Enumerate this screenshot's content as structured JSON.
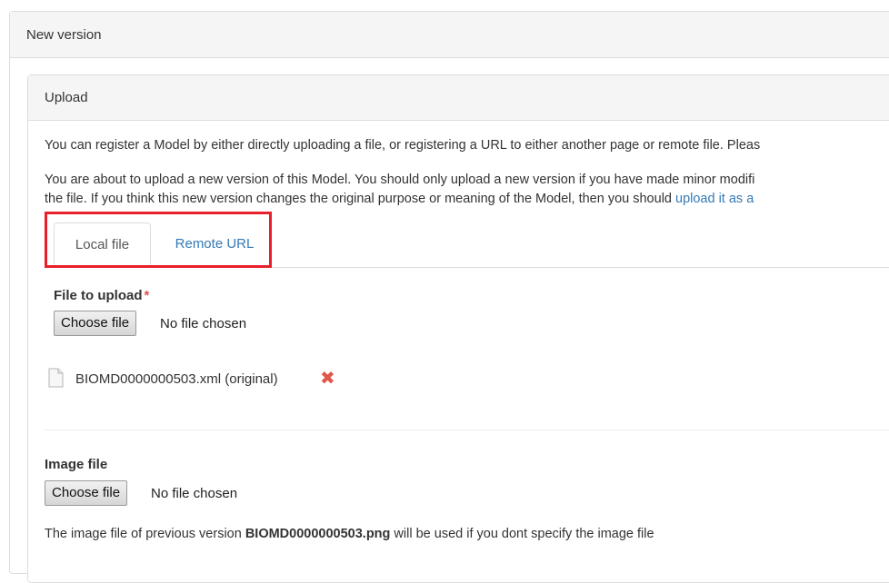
{
  "outer_panel": {
    "title": "New version"
  },
  "upload_panel": {
    "title": "Upload",
    "intro_text": "You can register a Model by either directly uploading a file, or registering a URL to either another page or remote file. Pleas",
    "version_text_line1": "You are about to upload a new version of this Model. You should only upload a new version if you have made minor modifi",
    "version_text_line2": "the file. If you think this new version changes the original purpose or meaning of the Model, then you should ",
    "version_link": "upload it as a"
  },
  "tabs": [
    {
      "label": "Local file",
      "active": true
    },
    {
      "label": "Remote URL",
      "active": false
    }
  ],
  "file_to_upload": {
    "label": "File to upload",
    "required_mark": "*",
    "button_label": "Choose file",
    "status": "No file chosen"
  },
  "existing_file": {
    "name": "BIOMD0000000503.xml (original)",
    "remove_icon": "✖"
  },
  "image_file": {
    "label": "Image file",
    "button_label": "Choose file",
    "status": "No file chosen",
    "help_prefix": "The image file of previous version ",
    "help_filename": "BIOMD0000000503.png",
    "help_suffix": " will be used if you dont specify the image file"
  },
  "colors": {
    "highlight": "#e8202a",
    "link": "#337ab7",
    "remove": "#e2574c"
  }
}
